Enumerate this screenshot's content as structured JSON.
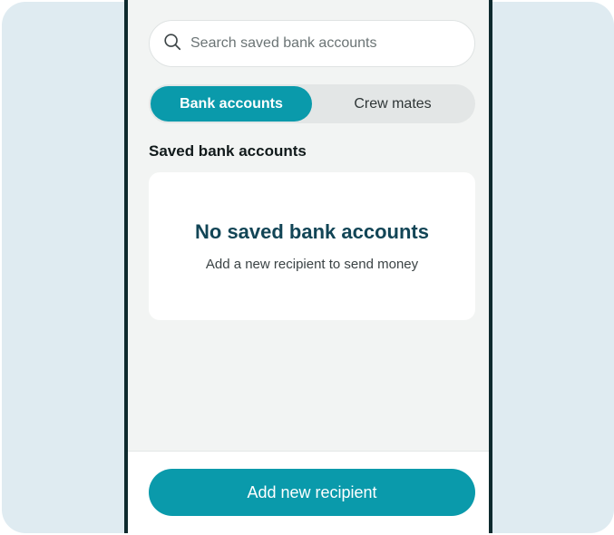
{
  "search": {
    "placeholder": "Search saved bank accounts",
    "icon": "search-icon"
  },
  "tabs": [
    {
      "label": "Bank accounts",
      "active": true
    },
    {
      "label": "Crew mates",
      "active": false
    }
  ],
  "section": {
    "title": "Saved bank accounts"
  },
  "empty_state": {
    "title": "No saved bank accounts",
    "subtitle": "Add a new recipient to send money"
  },
  "actions": {
    "add_recipient_label": "Add new recipient"
  },
  "colors": {
    "accent": "#0a9aab",
    "heading": "#124556",
    "backdrop": "#dfebf1",
    "frame": "#0e2a2e"
  }
}
